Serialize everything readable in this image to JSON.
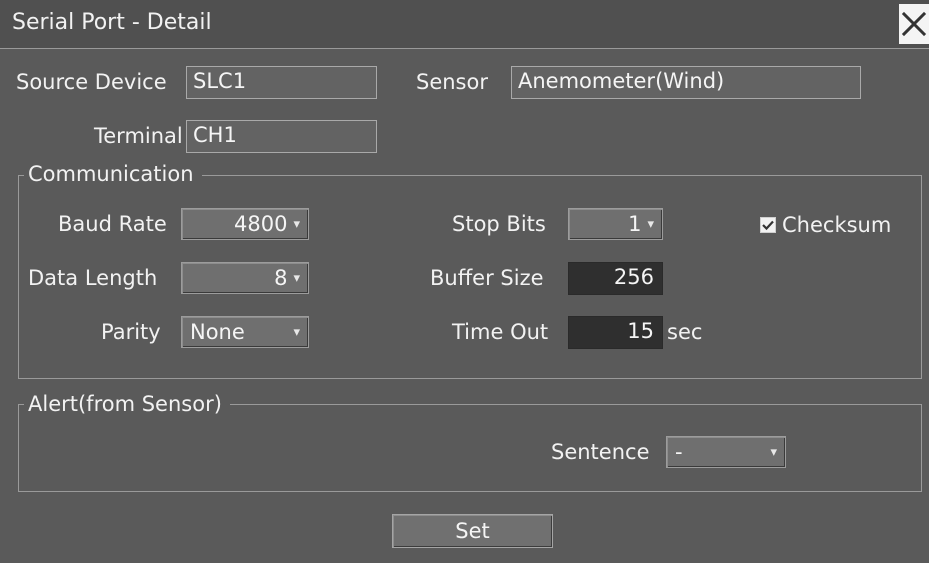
{
  "window": {
    "title": "Serial Port - Detail"
  },
  "source_device": {
    "label": "Source Device",
    "value": "SLC1"
  },
  "sensor": {
    "label": "Sensor",
    "value": "Anemometer(Wind)"
  },
  "terminal": {
    "label": "Terminal",
    "value": "CH1"
  },
  "communication": {
    "title": "Communication",
    "baud_rate": {
      "label": "Baud Rate",
      "value": "4800"
    },
    "data_length": {
      "label": "Data Length",
      "value": "8"
    },
    "parity": {
      "label": "Parity",
      "value": "None"
    },
    "stop_bits": {
      "label": "Stop Bits",
      "value": "1"
    },
    "buffer_size": {
      "label": "Buffer Size",
      "value": "256"
    },
    "time_out": {
      "label": "Time Out",
      "value": "15",
      "unit": "sec"
    },
    "checksum": {
      "label": "Checksum",
      "checked": true
    }
  },
  "alert": {
    "title": "Alert(from Sensor)",
    "sentence": {
      "label": "Sentence",
      "value": "-"
    }
  },
  "set_button": {
    "label": "Set"
  }
}
